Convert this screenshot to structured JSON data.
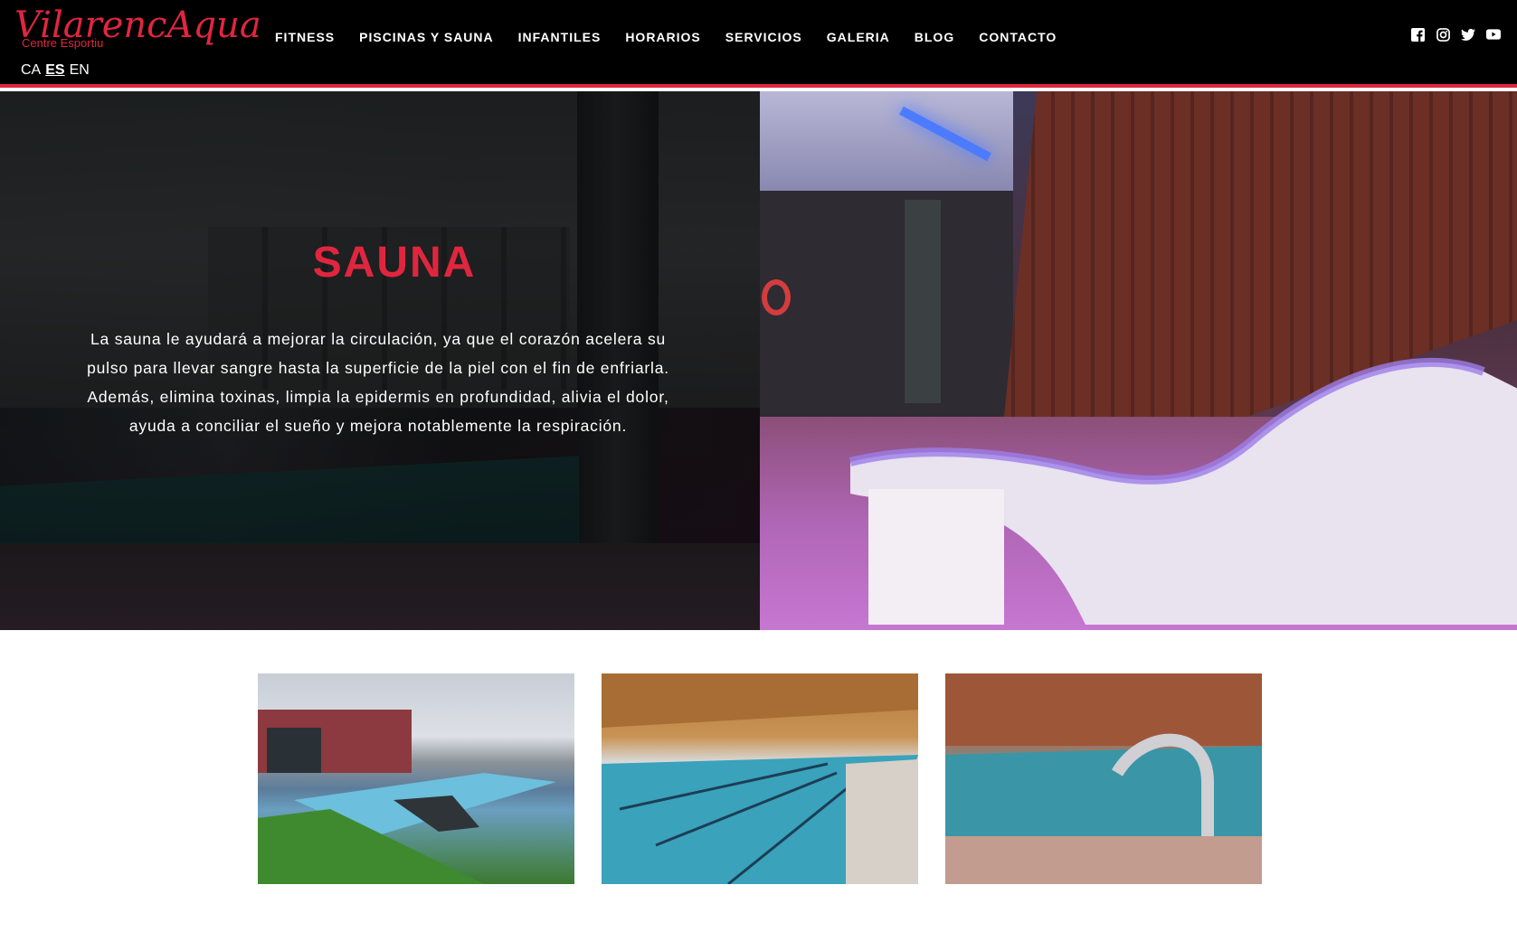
{
  "brand": {
    "name": "VilarencAqua",
    "tagline": "Centre Esportiu",
    "accent": "#e0263f"
  },
  "nav": {
    "items": [
      "FITNESS",
      "PISCINAS Y SAUNA",
      "INFANTILES",
      "HORARIOS",
      "SERVICIOS",
      "GALERIA",
      "BLOG",
      "CONTACTO"
    ]
  },
  "languages": {
    "items": [
      "CA",
      "ES",
      "EN"
    ],
    "active": "ES"
  },
  "social": {
    "icons": [
      "facebook-icon",
      "instagram-icon",
      "twitter-icon",
      "youtube-icon"
    ]
  },
  "hero": {
    "title": "SAUNA",
    "body": "La sauna le ayudará a mejorar la circulación, ya que el corazón acelera su pulso para llevar sangre hasta la superficie de la piel con el fin de enfriarla. Además, elimina toxinas, limpia la epidermis en profundidad, alivia el dolor, ayuda a conciliar el sueño y mejora notablemente la respiración."
  },
  "gallery": {
    "images": [
      "outdoor-pool-photo",
      "indoor-lap-pool-photo",
      "spa-pool-fountain-photo"
    ]
  }
}
